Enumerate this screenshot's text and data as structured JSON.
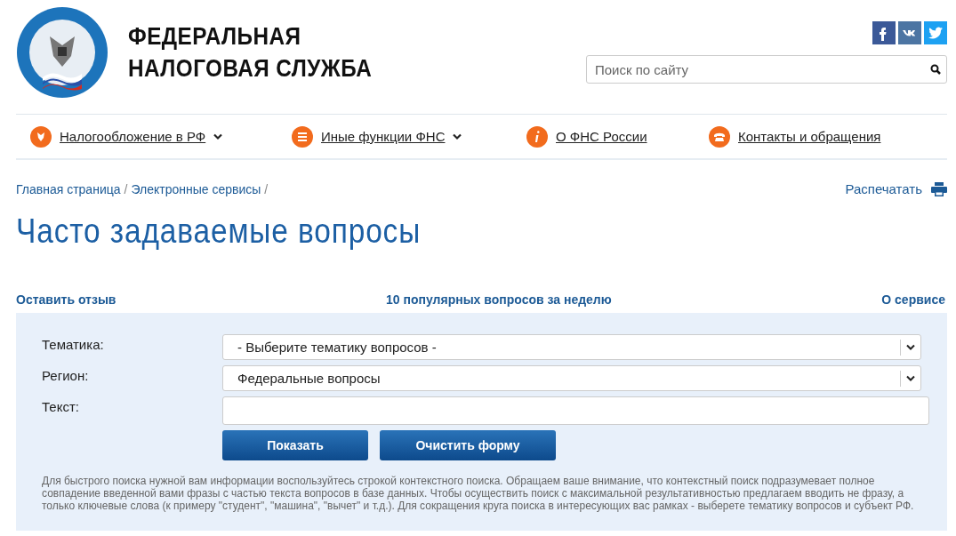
{
  "header": {
    "title_lines": [
      "ФЕДЕРАЛЬНАЯ",
      "НАЛОГОВАЯ СЛУЖБА"
    ],
    "social": [
      {
        "kind": "facebook",
        "color": "#3b5998"
      },
      {
        "kind": "vk",
        "color": "#4c75a3"
      },
      {
        "kind": "twitter",
        "color": "#1da1f2"
      }
    ],
    "search": {
      "placeholder": "Поиск по сайту"
    }
  },
  "nav": [
    {
      "label": "Налогообложение в РФ",
      "kind": "emblem",
      "dropdown": true
    },
    {
      "label": "Иные функции ФНС",
      "kind": "menu",
      "dropdown": true
    },
    {
      "label": "О ФНС России",
      "kind": "info",
      "dropdown": false
    },
    {
      "label": "Контакты и обращения",
      "kind": "phone",
      "dropdown": false
    }
  ],
  "breadcrumbs": [
    {
      "label": "Главная страница",
      "separator": "/"
    },
    {
      "label": "Электронные сервисы",
      "separator": "/"
    }
  ],
  "print": "Распечатать",
  "page_title": "Часто задаваемые вопросы",
  "links": [
    "Оставить отзыв",
    "10 популярных вопросов за неделю",
    "О сервисе"
  ],
  "form": {
    "fields": [
      {
        "label": "Тематика:",
        "kind": "select",
        "value": "- Выберите тематику вопросов -"
      },
      {
        "label": "Регион:",
        "kind": "select",
        "value": "Федеральные вопросы"
      },
      {
        "label": "Текст:",
        "kind": "text"
      }
    ],
    "buttons": [
      "Показать",
      "Очистить форму"
    ],
    "help": "Для быстрого поиска нужной вам информации воспользуйтесь строкой контекстного поиска. Обращаем ваше внимание, что контекстный поиск подразумевает полное совпадение введенной вами фразы с частью текста вопросов в базе данных. Чтобы осуществить поиск с максимальной результативностью предлагаем вводить не фразу, а только ключевые слова (к примеру \"студент\", \"машина\", \"вычет\" и т.д.). Для сокращения круга поиска в интересующих вас рамках - выберете тематику вопросов и субъект РФ."
  }
}
